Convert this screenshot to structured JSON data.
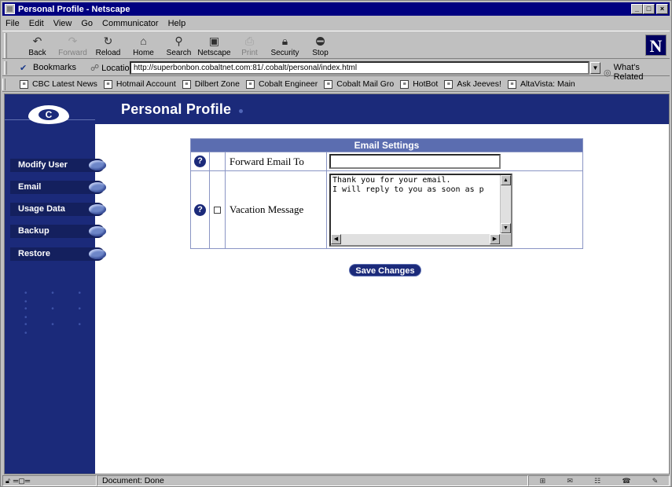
{
  "window": {
    "title": "Personal Profile - Netscape"
  },
  "menu": [
    "File",
    "Edit",
    "View",
    "Go",
    "Communicator",
    "Help"
  ],
  "toolbar": [
    {
      "label": "Back",
      "icon": "back-arrow-icon",
      "glyph": "↶",
      "enabled": true
    },
    {
      "label": "Forward",
      "icon": "forward-arrow-icon",
      "glyph": "↷",
      "enabled": false
    },
    {
      "label": "Reload",
      "icon": "reload-icon",
      "glyph": "↻",
      "enabled": true
    },
    {
      "label": "Home",
      "icon": "home-icon",
      "glyph": "⌂",
      "enabled": true
    },
    {
      "label": "Search",
      "icon": "search-icon",
      "glyph": "⚲",
      "enabled": true
    },
    {
      "label": "Netscape",
      "icon": "netscape-icon",
      "glyph": "▣",
      "enabled": true
    },
    {
      "label": "Print",
      "icon": "print-icon",
      "glyph": "⎙",
      "enabled": false
    },
    {
      "label": "Security",
      "icon": "lock-icon",
      "glyph": "🔒︎",
      "enabled": true
    },
    {
      "label": "Stop",
      "icon": "stop-icon",
      "glyph": "⛔︎",
      "enabled": true
    }
  ],
  "location": {
    "bookmarks_label": "Bookmarks",
    "location_label": "Location:",
    "url": "http://superbonbon.cobaltnet.com:81/.cobalt/personal/index.html",
    "related_label": "What's Related"
  },
  "links": [
    "CBC Latest News",
    "Hotmail Account",
    "Dilbert Zone",
    "Cobalt Engineer",
    "Cobalt Mail Gro",
    "HotBot",
    "Ask Jeeves!",
    "AltaVista: Main"
  ],
  "page": {
    "title": "Personal Profile",
    "logo_glyph": "C",
    "nav": [
      "Modify User",
      "Email",
      "Usage Data",
      "Backup",
      "Restore"
    ],
    "dots": "• • • •",
    "form": {
      "heading": "Email Settings",
      "help_glyph": "?",
      "forward_label": "Forward Email To",
      "forward_value": "",
      "vacation_label": "Vacation Message",
      "vacation_enabled": false,
      "vacation_text": "Thank you for your email.\nI will reply to you as soon as p"
    },
    "save_label": "Save Changes"
  },
  "status": {
    "text": "Document: Done"
  }
}
